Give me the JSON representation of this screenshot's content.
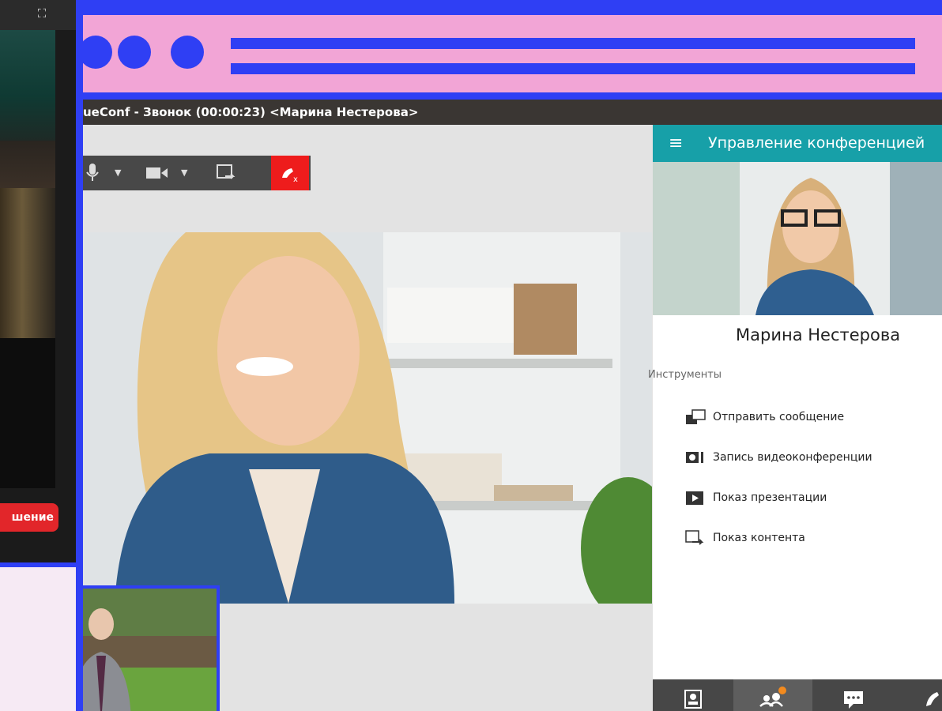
{
  "background_window": {
    "button_label": "шение",
    "accent_color": "#e2262a"
  },
  "browser": {
    "frame_color": "#2f3ff4",
    "header_color": "#f2a5d6"
  },
  "call": {
    "title": "ueConf - Звонок (00:00:23) <Марина Нестерова>",
    "toolbar": {
      "mic_icon": "microphone-icon",
      "camera_icon": "camera-icon",
      "share_icon": "screen-share-icon",
      "hangup_icon": "hangup-icon",
      "hangup_color": "#ee1c1c"
    }
  },
  "panel": {
    "header_title": "Управление конференцией",
    "header_color": "#17a0a8",
    "participant_name": "Марина Нестерова",
    "tools_label": "Инструменты",
    "tools": [
      {
        "label": "Отправить сообщение",
        "icon": "message-icon"
      },
      {
        "label": "Запись видеоконференции",
        "icon": "record-icon"
      },
      {
        "label": "Показ презентации",
        "icon": "presentation-icon"
      },
      {
        "label": "Показ контента",
        "icon": "content-share-icon"
      }
    ],
    "tabs": [
      {
        "icon": "contacts-icon",
        "active": false
      },
      {
        "icon": "participants-icon",
        "active": true
      },
      {
        "icon": "chat-icon",
        "active": false
      },
      {
        "icon": "call-icon",
        "active": false
      }
    ]
  }
}
